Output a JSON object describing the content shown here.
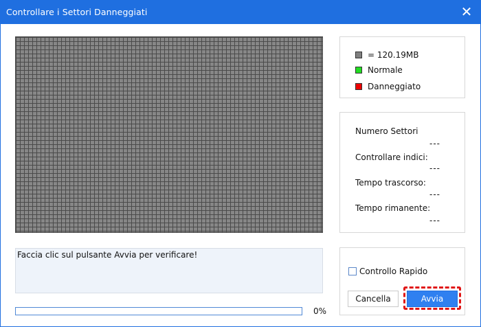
{
  "window": {
    "title": "Controllare i Settori Danneggiati",
    "close_glyph": "✕"
  },
  "legend": {
    "items": [
      {
        "label": "= 120.19MB",
        "color": "#808080"
      },
      {
        "label": "Normale",
        "color": "#22dd22"
      },
      {
        "label": "Danneggiato",
        "color": "#ee0000"
      }
    ]
  },
  "stats": {
    "sector_count_label": "Numero Settori",
    "sector_count_value": "---",
    "index_label": "Controllare indici:",
    "index_value": "---",
    "elapsed_label": "Tempo trascorso:",
    "elapsed_value": "---",
    "remaining_label": "Tempo rimanente:",
    "remaining_value": "---"
  },
  "message": {
    "text": "Faccia clic sul pulsante Avvia per verificare!"
  },
  "progress": {
    "value": 0,
    "percent_text": "0%"
  },
  "actions": {
    "quick_check_label": "Controllo Rapido",
    "quick_check_checked": false,
    "cancel_label": "Cancella",
    "start_label": "Avvia"
  },
  "colors": {
    "accent": "#1f6fe0",
    "highlight": "#e01515"
  }
}
